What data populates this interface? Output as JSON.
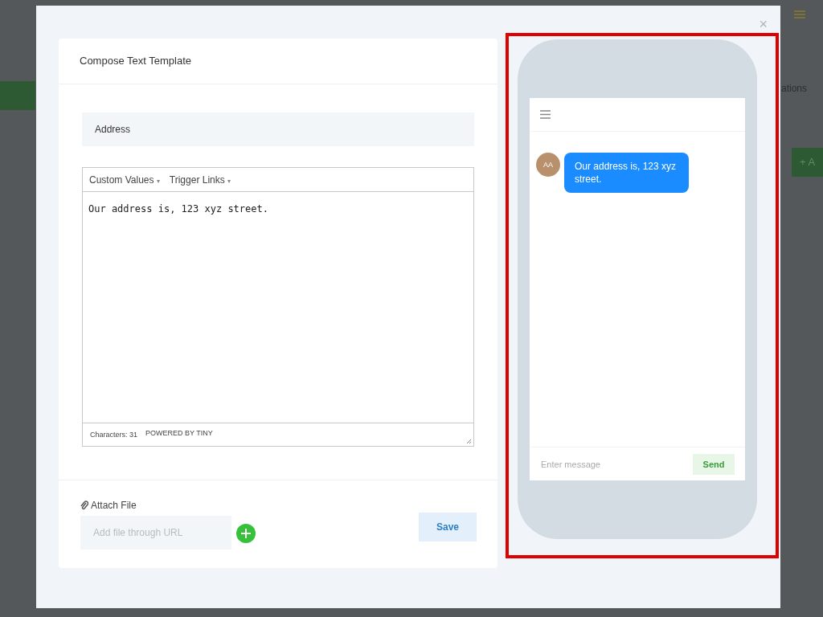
{
  "background": {
    "fragments": [
      "ations"
    ],
    "button_label": "+ A"
  },
  "modal": {
    "close": "×"
  },
  "composer": {
    "title": "Compose Text Template",
    "name_value": "Address",
    "toolbar": [
      {
        "label": "Custom Values",
        "caret": "▾"
      },
      {
        "label": "Trigger Links",
        "caret": "▾"
      }
    ],
    "body": "Our address is, 123 xyz street.",
    "status": {
      "count": "Characters: 31",
      "brand": "POWERED BY TINY"
    },
    "attach_label": "Attach File",
    "url_placeholder": "Add file through URL",
    "save": "Save"
  },
  "preview": {
    "highlighted": true,
    "messages": [
      {
        "avatar": "AA",
        "text": "Our address is, 123 xyz street."
      }
    ],
    "input_placeholder": "Enter message",
    "send": "Send"
  }
}
